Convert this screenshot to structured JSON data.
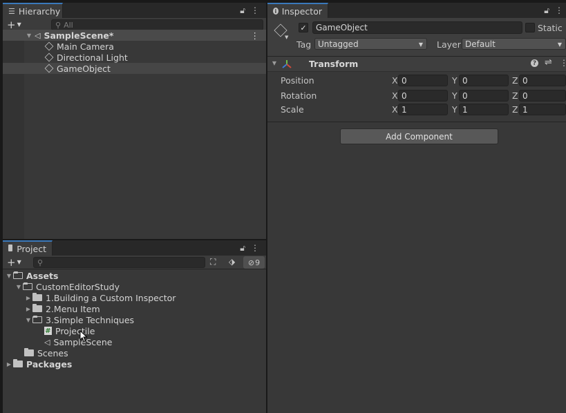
{
  "hierarchy": {
    "tab_label": "Hierarchy",
    "search_placeholder": "All",
    "scene_name": "SampleScene*",
    "items": [
      {
        "label": "Main Camera"
      },
      {
        "label": "Directional Light"
      },
      {
        "label": "GameObject"
      }
    ]
  },
  "project": {
    "tab_label": "Project",
    "hidden_count": "9",
    "tree": {
      "assets": "Assets",
      "custom_editor_study": "CustomEditorStudy",
      "building_inspector": "1.Building a Custom Inspector",
      "menu_item": "2.Menu Item",
      "simple_techniques": "3.Simple Techniques",
      "projectile": "Projectile",
      "sample_scene": "SampleScene",
      "scenes": "Scenes",
      "packages": "Packages"
    }
  },
  "inspector": {
    "tab_label": "Inspector",
    "object_name": "GameObject",
    "static_label": "Static",
    "tag_label": "Tag",
    "tag_value": "Untagged",
    "layer_label": "Layer",
    "layer_value": "Default",
    "transform": {
      "title": "Transform",
      "position_label": "Position",
      "rotation_label": "Rotation",
      "scale_label": "Scale",
      "axis_x": "X",
      "axis_y": "Y",
      "axis_z": "Z",
      "position": {
        "x": "0",
        "y": "0",
        "z": "0"
      },
      "rotation": {
        "x": "0",
        "y": "0",
        "z": "0"
      },
      "scale": {
        "x": "1",
        "y": "1",
        "z": "1"
      }
    },
    "add_component_label": "Add Component"
  },
  "colors": {
    "accent": "#3a79bb",
    "panel_bg": "#383838",
    "selection_bg": "#464646"
  },
  "icons": [
    "list-icon",
    "lock-icon",
    "kebab-menu-icon",
    "plus-icon",
    "search-icon",
    "unity-scene-icon",
    "cube-icon",
    "folder-icon",
    "script-icon",
    "info-icon",
    "checkbox-icon",
    "transform-icon",
    "help-icon",
    "preset-icon",
    "filter-type-icon",
    "label-tag-icon",
    "hidden-packages-icon"
  ]
}
